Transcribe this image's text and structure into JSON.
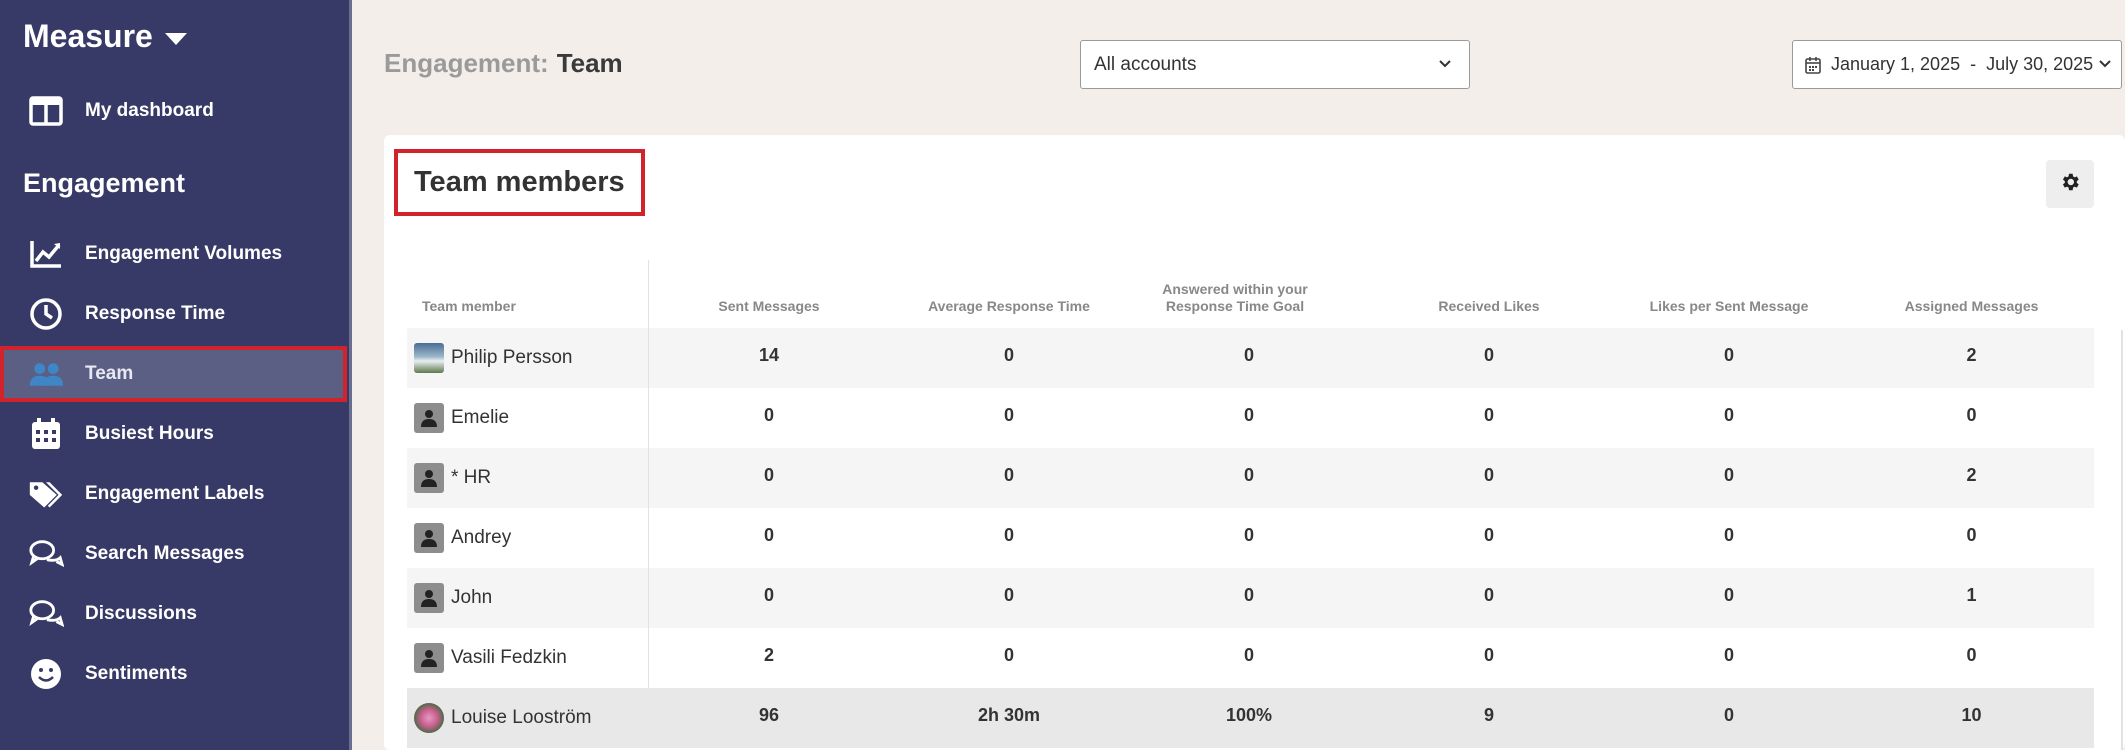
{
  "sidebar": {
    "header": "Measure",
    "top_items": [
      {
        "label": "My dashboard",
        "icon": "dashboard-icon"
      }
    ],
    "section": "Engagement",
    "items": [
      {
        "label": "Engagement Volumes",
        "icon": "trend-chart-icon"
      },
      {
        "label": "Response Time",
        "icon": "clock-icon"
      },
      {
        "label": "Team",
        "icon": "people-icon",
        "active": true
      },
      {
        "label": "Busiest Hours",
        "icon": "calendar-icon"
      },
      {
        "label": "Engagement Labels",
        "icon": "tags-icon"
      },
      {
        "label": "Search Messages",
        "icon": "chat-bubbles-icon"
      },
      {
        "label": "Discussions",
        "icon": "chat-bubbles-icon"
      },
      {
        "label": "Sentiments",
        "icon": "smiley-icon"
      }
    ],
    "colors": {
      "background": "#373a66",
      "active_bg": "#5c5f84",
      "highlight": "#d0232b"
    }
  },
  "header": {
    "title_prefix": "Engagement:",
    "title": "Team",
    "account_select": {
      "value": "All accounts"
    },
    "date_range": {
      "start": "January 1, 2025",
      "separator": "-",
      "end": "July 30, 2025"
    }
  },
  "card": {
    "title": "Team members",
    "settings_icon": "gear-icon"
  },
  "table": {
    "columns": [
      "Team member",
      "Sent Messages",
      "Average Response Time",
      "Answered within your Response Time Goal",
      "Received Likes",
      "Likes per Sent Message",
      "Assigned Messages"
    ],
    "rows": [
      {
        "name": "Philip Persson",
        "avatar": "photo-mountain",
        "values": [
          "14",
          "0",
          "0",
          "0",
          "0",
          "2"
        ]
      },
      {
        "name": "Emelie",
        "avatar": "default",
        "values": [
          "0",
          "0",
          "0",
          "0",
          "0",
          "0"
        ]
      },
      {
        "name": "* HR",
        "avatar": "default",
        "values": [
          "0",
          "0",
          "0",
          "0",
          "0",
          "2"
        ]
      },
      {
        "name": "Andrey",
        "avatar": "default",
        "values": [
          "0",
          "0",
          "0",
          "0",
          "0",
          "0"
        ]
      },
      {
        "name": "John",
        "avatar": "default",
        "values": [
          "0",
          "0",
          "0",
          "0",
          "0",
          "1"
        ]
      },
      {
        "name": "Vasili Fedzkin",
        "avatar": "default",
        "values": [
          "2",
          "0",
          "0",
          "0",
          "0",
          "0"
        ]
      },
      {
        "name": "Louise Looström",
        "avatar": "photo-flower",
        "values": [
          "96",
          "2h 30m",
          "100%",
          "9",
          "0",
          "10"
        ]
      }
    ]
  }
}
